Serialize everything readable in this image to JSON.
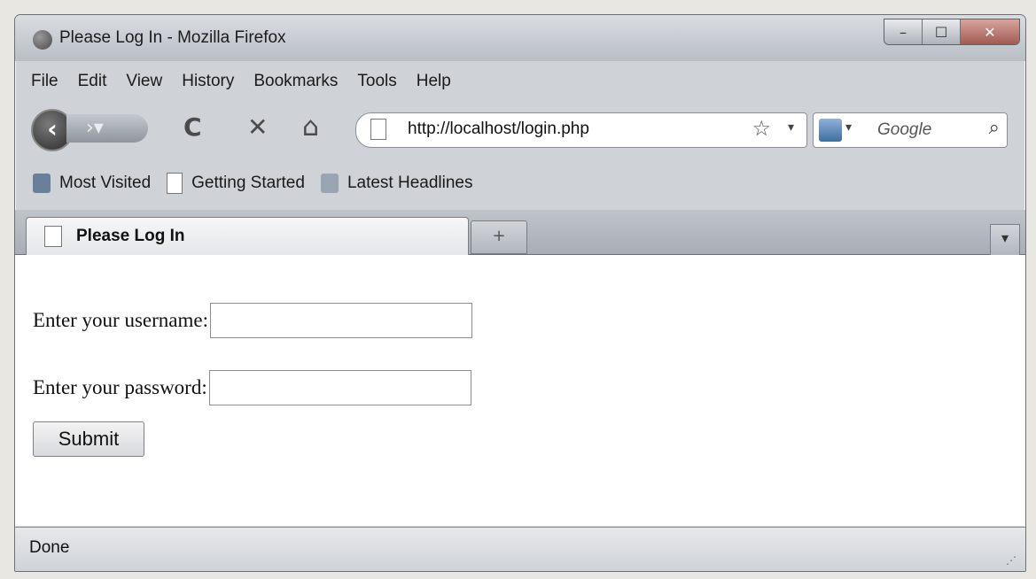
{
  "window": {
    "title": "Please Log In - Mozilla Firefox",
    "minimize": "–",
    "maximize": "☐",
    "close": "✕"
  },
  "menu": {
    "file": "File",
    "edit": "Edit",
    "view": "View",
    "history": "History",
    "bookmarks": "Bookmarks",
    "tools": "Tools",
    "help": "Help"
  },
  "nav": {
    "back_icon": "arrow-left-icon",
    "reload": "C",
    "stop": "✕",
    "home": "⌂",
    "url": "http://localhost/login.php",
    "bookmark_star": "☆",
    "url_dropdown": "▾",
    "search_placeholder": "Google",
    "search_dropdown": "▾",
    "search_icon": "⌕"
  },
  "bookmarks_bar": {
    "most_visited": "Most Visited",
    "getting_started": "Getting Started",
    "latest_headlines": "Latest Headlines"
  },
  "tabs": {
    "active_label": "Please Log In",
    "new_tab": "+",
    "list_all": "▾"
  },
  "form": {
    "username_label": "Enter your username:",
    "username_value": "",
    "password_label": "Enter your password:",
    "password_value": "",
    "submit_label": "Submit"
  },
  "status": {
    "text": "Done"
  }
}
